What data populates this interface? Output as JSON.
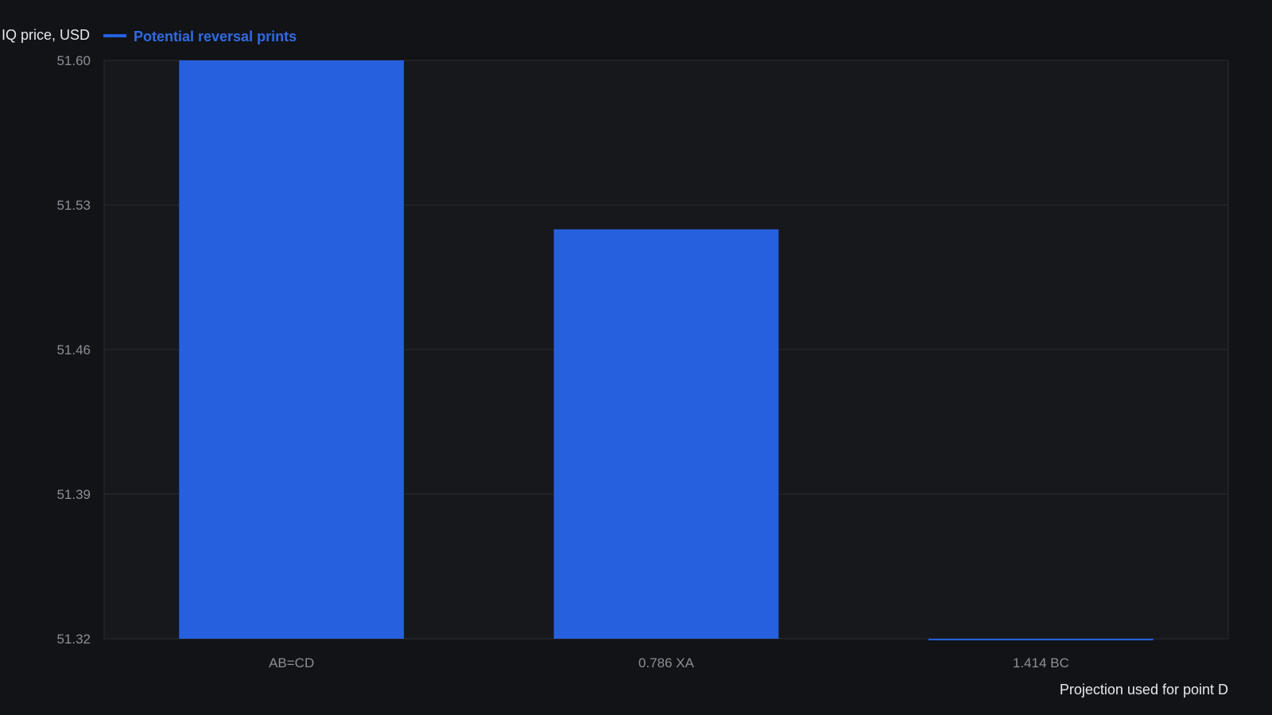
{
  "chart_data": {
    "type": "bar",
    "categories": [
      "AB=CD",
      "0.786 XA",
      "1.414 BC"
    ],
    "series": [
      {
        "name": "Potential reversal prints",
        "values": [
          51.6,
          51.5182,
          51.3195
        ]
      }
    ],
    "ylabel": "IQ price, USD",
    "xlabel": "Projection used for point D",
    "ylim": [
      51.32,
      51.6
    ],
    "yticks": [
      "51.60",
      "51.53",
      "51.46",
      "51.39",
      "51.32"
    ],
    "grid": true,
    "legend_position": "top-left"
  },
  "colors": {
    "background": "#111317",
    "plot_background": "#16181c",
    "bar": "#2660de",
    "grid": "#2a2d33",
    "legend_text": "#2f6be3"
  }
}
